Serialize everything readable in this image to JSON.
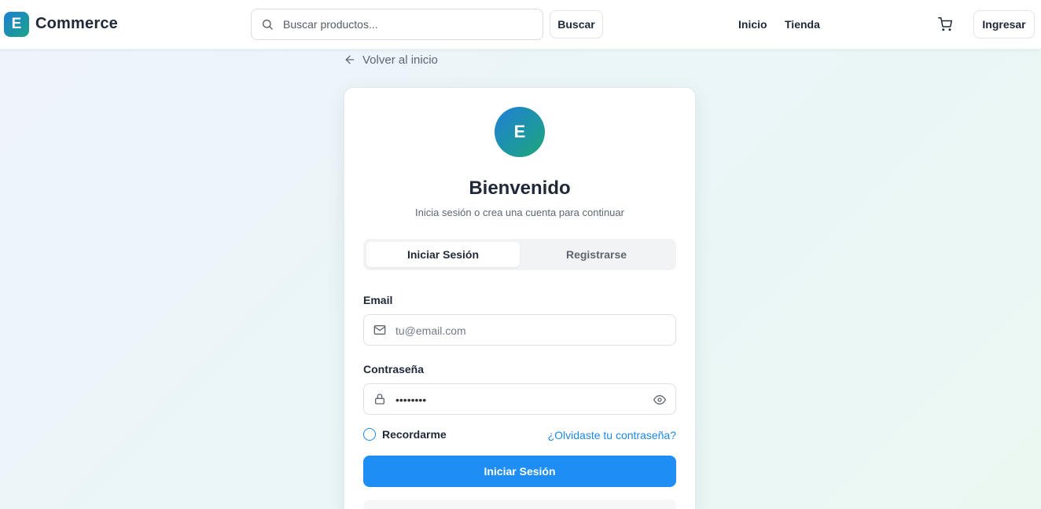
{
  "header": {
    "logo_letter": "E",
    "brand": "Commerce",
    "search_placeholder": "Buscar productos...",
    "search_button": "Buscar",
    "nav": [
      {
        "label": "Inicio"
      },
      {
        "label": "Tienda"
      }
    ],
    "cart_icon": "cart-icon",
    "login_button": "Ingresar"
  },
  "back_link": "Volver al inicio",
  "card": {
    "avatar_letter": "E",
    "title": "Bienvenido",
    "subtitle": "Inicia sesión o crea una cuenta para continuar",
    "tabs": [
      {
        "label": "Iniciar Sesión",
        "active": true
      },
      {
        "label": "Registrarse",
        "active": false
      }
    ],
    "email_label": "Email",
    "email_placeholder": "tu@email.com",
    "password_label": "Contraseña",
    "password_value": "password",
    "remember_label": "Recordarme",
    "forgot_link": "¿Olvidaste tu contraseña?",
    "submit_button": "Iniciar Sesión"
  },
  "colors": {
    "primary": "#1e8ef5",
    "link": "#1e88e5",
    "brand_gradient_start": "#1d7fd6",
    "brand_gradient_end": "#1ba486"
  }
}
